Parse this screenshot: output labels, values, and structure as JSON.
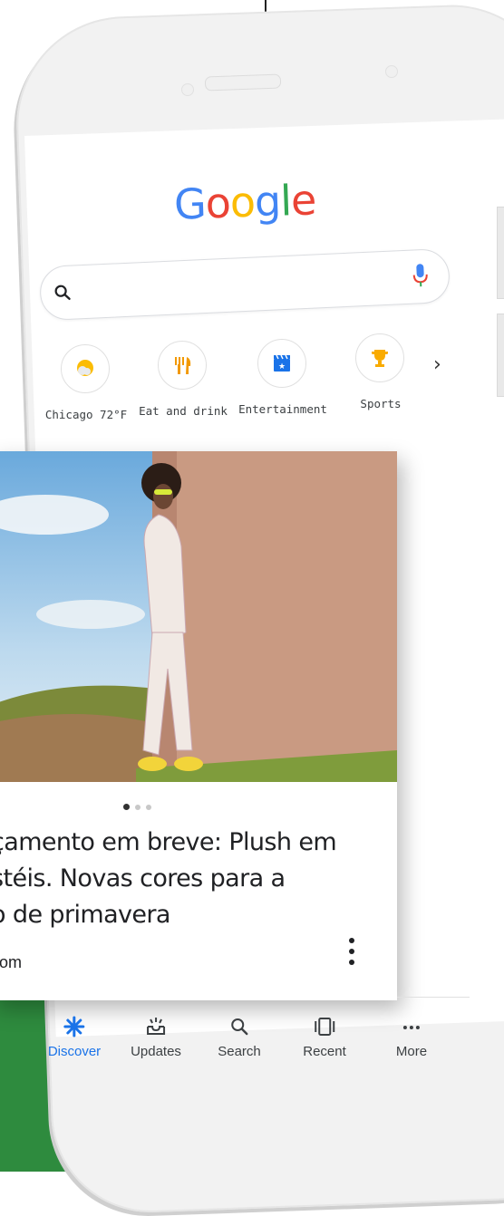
{
  "google_logo": [
    "G",
    "o",
    "o",
    "g",
    "l",
    "e"
  ],
  "logo_colors": [
    "#4285F4",
    "#EA4335",
    "#FBBC05",
    "#4285F4",
    "#34A853",
    "#EA4335"
  ],
  "search": {
    "placeholder": "",
    "icon": "search-icon",
    "mic_icon": "mic-icon"
  },
  "quick_chips": [
    {
      "label": "Chicago 72°F",
      "icon": "weather-icon"
    },
    {
      "label": "Eat and drink",
      "icon": "restaurant-icon"
    },
    {
      "label": "Entertainment",
      "icon": "clapperboard-icon"
    },
    {
      "label": "Sports",
      "icon": "trophy-icon"
    }
  ],
  "card": {
    "title_lines": [
      "çamento em breve: Plush em",
      "stéis. Novas cores para a",
      "o de primavera"
    ],
    "source": "com",
    "carousel_dots": 3,
    "active_dot": 1
  },
  "bottom_nav": [
    {
      "label": "Discover",
      "icon": "discover-icon",
      "active": true
    },
    {
      "label": "Updates",
      "icon": "updates-icon",
      "active": false
    },
    {
      "label": "Search",
      "icon": "search-icon",
      "active": false
    },
    {
      "label": "Recent",
      "icon": "recent-icon",
      "active": false
    },
    {
      "label": "More",
      "icon": "more-icon",
      "active": false
    }
  ],
  "colors": {
    "accent": "#1a73e8",
    "green": "#2e8b3e",
    "mic_blue": "#4285F4",
    "mic_red": "#EA4335"
  }
}
